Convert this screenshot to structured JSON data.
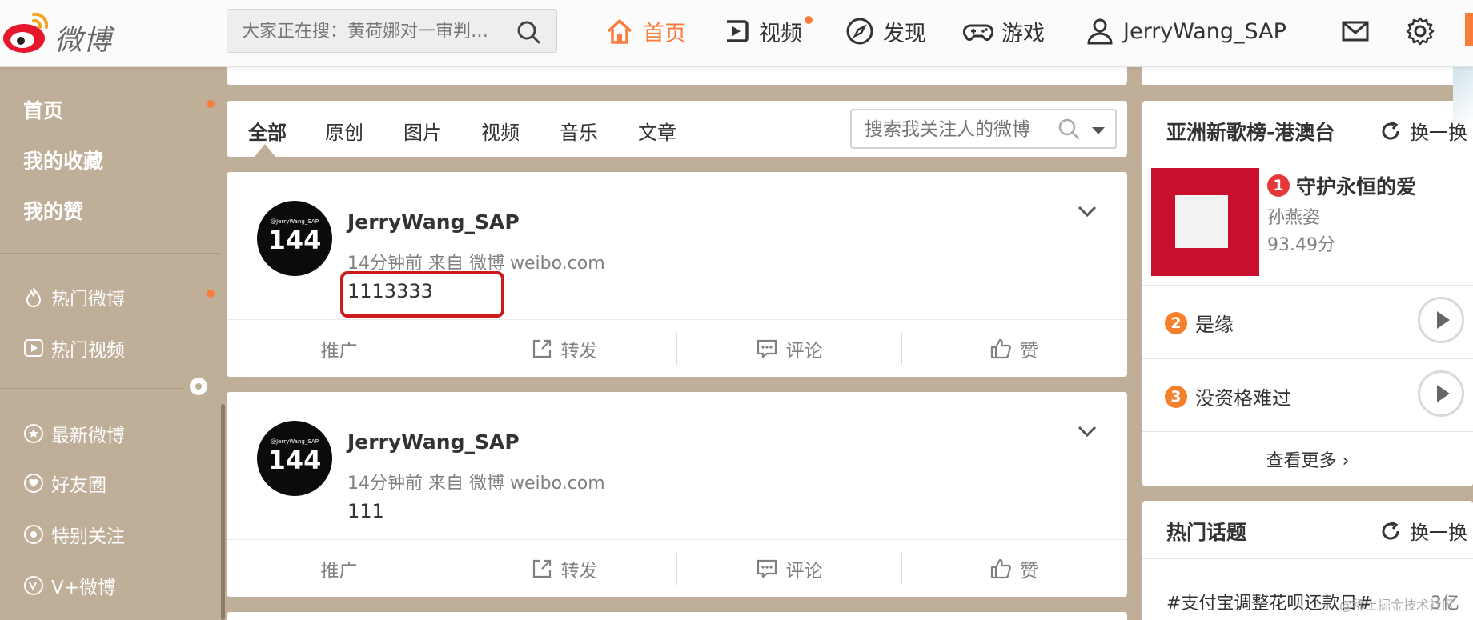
{
  "header": {
    "logo_text": "微博",
    "search_placeholder": "大家正在搜：黄荷娜对一审判…",
    "nav": [
      {
        "label": "首页",
        "icon": "home-icon",
        "active": true
      },
      {
        "label": "视频",
        "icon": "video-icon",
        "active": false,
        "badge_dot": true
      },
      {
        "label": "发现",
        "icon": "compass-icon",
        "active": false
      },
      {
        "label": "游戏",
        "icon": "gamepad-icon",
        "active": false
      },
      {
        "label": "JerryWang_SAP",
        "icon": "user-icon",
        "active": false
      }
    ],
    "icons": [
      "mail-icon",
      "gear-icon"
    ]
  },
  "sidebar": {
    "main_items": [
      "首页",
      "我的收藏",
      "我的赞"
    ],
    "hot_items": [
      {
        "label": "热门微博",
        "icon": "flame-icon"
      },
      {
        "label": "热门视频",
        "icon": "play-icon"
      }
    ],
    "group_items": [
      {
        "label": "最新微博",
        "icon": "star-icon"
      },
      {
        "label": "好友圈",
        "icon": "heart-icon"
      },
      {
        "label": "特别关注",
        "icon": "target-icon"
      },
      {
        "label": "V+微博",
        "icon": "v-plus-icon"
      }
    ]
  },
  "feed": {
    "tabs": [
      "全部",
      "原创",
      "图片",
      "视频",
      "音乐",
      "文章"
    ],
    "active_tab": "全部",
    "search_placeholder": "搜索我关注人的微博",
    "posts": [
      {
        "avatar_small": "@JerryWang_SAP",
        "avatar_big": "144",
        "author": "JerryWang_SAP",
        "meta": "14分钟前 来自 微博 weibo.com",
        "text": "1113333",
        "highlighted": true
      },
      {
        "avatar_small": "@JerryWang_SAP",
        "avatar_big": "144",
        "author": "JerryWang_SAP",
        "meta": "14分钟前 来自 微博 weibo.com",
        "text": "111",
        "highlighted": false
      }
    ],
    "actions": [
      "推广",
      "转发",
      "评论",
      "赞"
    ]
  },
  "chart_card": {
    "title": "亚洲新歌榜-港澳台",
    "refresh_label": "换一换",
    "top_song": {
      "rank": "1",
      "title": "守护永恒的爱",
      "artist": "孙燕姿",
      "score": "93.49分"
    },
    "songs": [
      {
        "rank": "2",
        "title": "是缘"
      },
      {
        "rank": "3",
        "title": "没资格难过"
      }
    ],
    "more_label": "查看更多 ›",
    "rank_colors": {
      "1": "#e63838",
      "2": "#f5812d",
      "3": "#f5812d"
    }
  },
  "topics_card": {
    "title": "热门话题",
    "refresh_label": "换一换",
    "items": [
      {
        "topic": "#支付宝调整花呗还款日#",
        "count": "3亿"
      }
    ]
  },
  "watermark": "@稀土掘金技术社区",
  "colors": {
    "accent": "#fa7d3c",
    "sidebar_bg": "#bfae98",
    "highlight_border": "#cc1b1b"
  }
}
